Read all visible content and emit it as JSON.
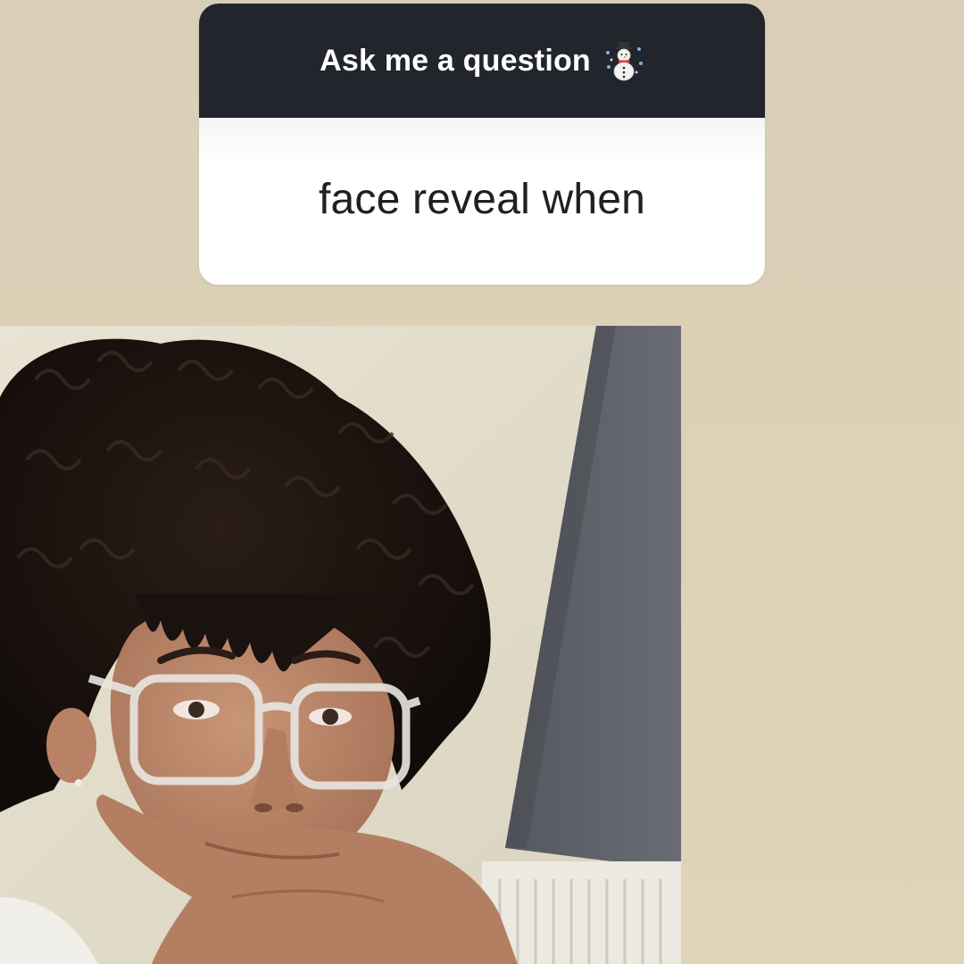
{
  "question_sticker": {
    "title": "Ask me a question",
    "title_icon": "snowman-icon",
    "question": "face reveal when"
  },
  "photo": {
    "alt_subject": "selfie-photo"
  },
  "colors": {
    "background": "#ddd1b5",
    "card_header": "#22252b",
    "card_body": "#ffffff",
    "title_text": "#ffffff",
    "question_text": "#202020"
  }
}
